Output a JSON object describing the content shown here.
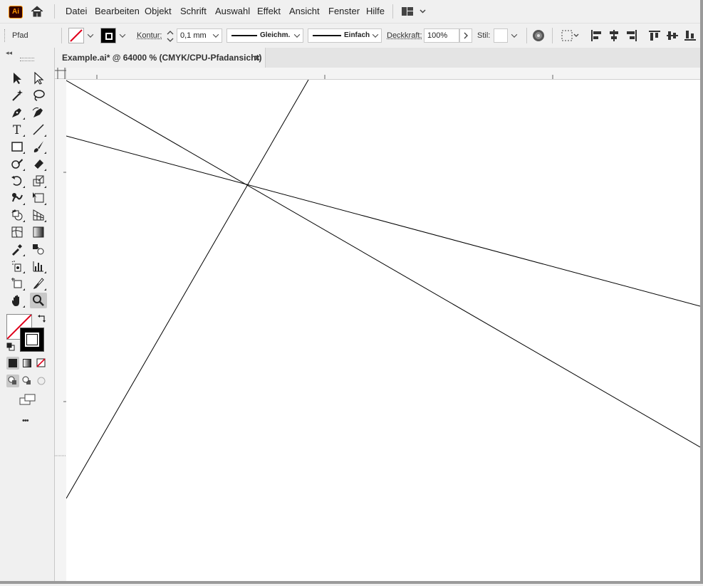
{
  "app": {
    "logo_text": "Ai"
  },
  "menu": {
    "items": [
      "Datei",
      "Bearbeiten",
      "Objekt",
      "Schrift",
      "Auswahl",
      "Effekt",
      "Ansicht",
      "Fenster",
      "Hilfe"
    ]
  },
  "control_bar": {
    "selection_type": "Pfad",
    "stroke_label": "Kontur:",
    "stroke_weight": "0,1 mm",
    "variable_width_profile": "Gleichm.",
    "brush_definition": "Einfach",
    "opacity_label": "Deckkraft:",
    "opacity_value": "100%",
    "style_label": "Stil:"
  },
  "document": {
    "tab_title": "Example.ai* @ 64000 % (CMYK/CPU-Pfadansicht)",
    "close_glyph": "×"
  },
  "toolbar": {
    "more_glyph": "•••",
    "tools": [
      "selection-tool",
      "direct-selection-tool",
      "magic-wand-tool",
      "lasso-tool",
      "pen-tool",
      "curvature-tool",
      "type-tool",
      "line-segment-tool",
      "rectangle-tool",
      "paintbrush-tool",
      "shaper-tool",
      "eraser-tool",
      "rotate-tool",
      "scale-tool",
      "warp-tool",
      "free-transform-tool",
      "shape-builder-tool",
      "perspective-grid-tool",
      "mesh-tool",
      "gradient-tool",
      "eyedropper-tool",
      "blend-tool",
      "symbol-sprayer-tool",
      "column-graph-tool",
      "artboard-tool",
      "slice-tool",
      "hand-tool",
      "zoom-tool"
    ],
    "selected_tool": "zoom-tool"
  },
  "colors": {
    "fill": "none",
    "stroke": "#000000",
    "none_slash": "#e0001b"
  }
}
